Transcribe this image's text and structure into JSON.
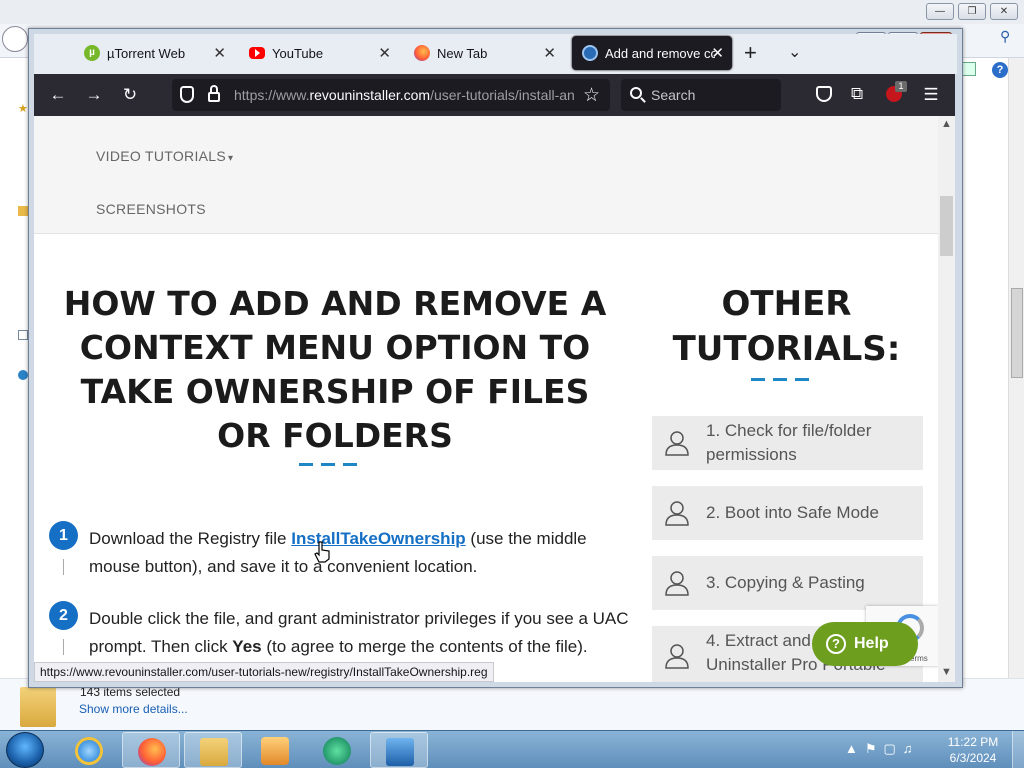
{
  "browser": {
    "tabs": [
      {
        "label": "µTorrent Web",
        "icon": "utorrent-icon",
        "active": false
      },
      {
        "label": "YouTube",
        "icon": "youtube-icon",
        "active": false
      },
      {
        "label": "New Tab",
        "icon": "firefox-icon",
        "active": false
      },
      {
        "label": "Add and remove co",
        "icon": "revo-icon",
        "active": true
      }
    ],
    "url_prefix": "https://www.",
    "url_domain": "revouninstaller.com",
    "url_path": "/user-tutorials/install-an",
    "search_placeholder": "Search",
    "notification_badge": "1"
  },
  "page": {
    "nav": [
      "VIDEO TUTORIALS",
      "SCREENSHOTS"
    ],
    "nav_caret": "▾",
    "title": "HOW TO ADD AND REMOVE A CONTEXT MENU OPTION TO TAKE OWNERSHIP OF FILES OR FOLDERS",
    "steps": [
      {
        "num": "1",
        "pre": "Download the Registry file ",
        "link": "InstallTakeOwnership",
        "post": " (use the middle mouse button), and save it to a convenient location."
      },
      {
        "num": "2",
        "pre": "Double click the file, and grant administrator privileges if you see a UAC prompt. Then click ",
        "bold": "Yes",
        "post": " (to agree to merge the contents of the file)."
      }
    ],
    "sidebar_title": "OTHER TUTORIALS:",
    "tutorials": [
      "1. Check for file/folder permissions",
      "2. Boot into Safe Mode",
      "3. Copying & Pasting",
      "4. Extract and add Revo Uninstaller Pro Portable"
    ],
    "help_label": "Help",
    "recaptcha_text": "Terms"
  },
  "status_url": "https://www.revouninstaller.com/user-tutorials-new/registry/InstallTakeOwnership.reg",
  "explorer": {
    "selection": "143 items selected",
    "details_link": "Show more details..."
  },
  "taskbar": {
    "time": "11:22 PM",
    "date": "6/3/2024"
  },
  "colors": {
    "accent": "#1570c5",
    "help_button": "#6d9e1e",
    "toolbar": "#2b2a33"
  }
}
